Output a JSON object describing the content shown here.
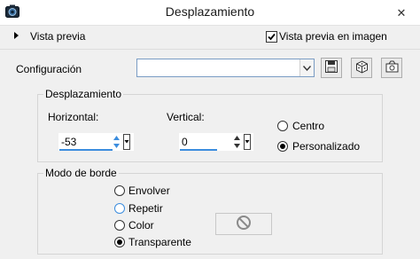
{
  "window": {
    "title": "Desplazamiento",
    "close_icon": "close-icon"
  },
  "preview": {
    "toggle_label": "Vista previa",
    "image_preview_label": "Vista previa en imagen",
    "image_preview_checked": true
  },
  "config": {
    "label": "Configuración",
    "selected_value": "",
    "buttons": [
      "save-preset-icon",
      "randomize-dice-icon",
      "reset-icon"
    ]
  },
  "displacement": {
    "title": "Desplazamiento",
    "horizontal_label": "Horizontal:",
    "horizontal_value": "-53",
    "vertical_label": "Vertical:",
    "vertical_value": "0",
    "options": [
      {
        "label": "Centro",
        "selected": false
      },
      {
        "label": "Personalizado",
        "selected": true
      }
    ]
  },
  "border_mode": {
    "title": "Modo de borde",
    "options": [
      {
        "label": "Envolver",
        "selected": false
      },
      {
        "label": "Repetir",
        "selected": false
      },
      {
        "label": "Color",
        "selected": false
      },
      {
        "label": "Transparente",
        "selected": true
      }
    ],
    "color_swatch_icon": "disabled-circle-icon"
  },
  "colors": {
    "accent": "#3c8dde",
    "border": "#d5d5d5",
    "background": "#f0f0f0"
  }
}
